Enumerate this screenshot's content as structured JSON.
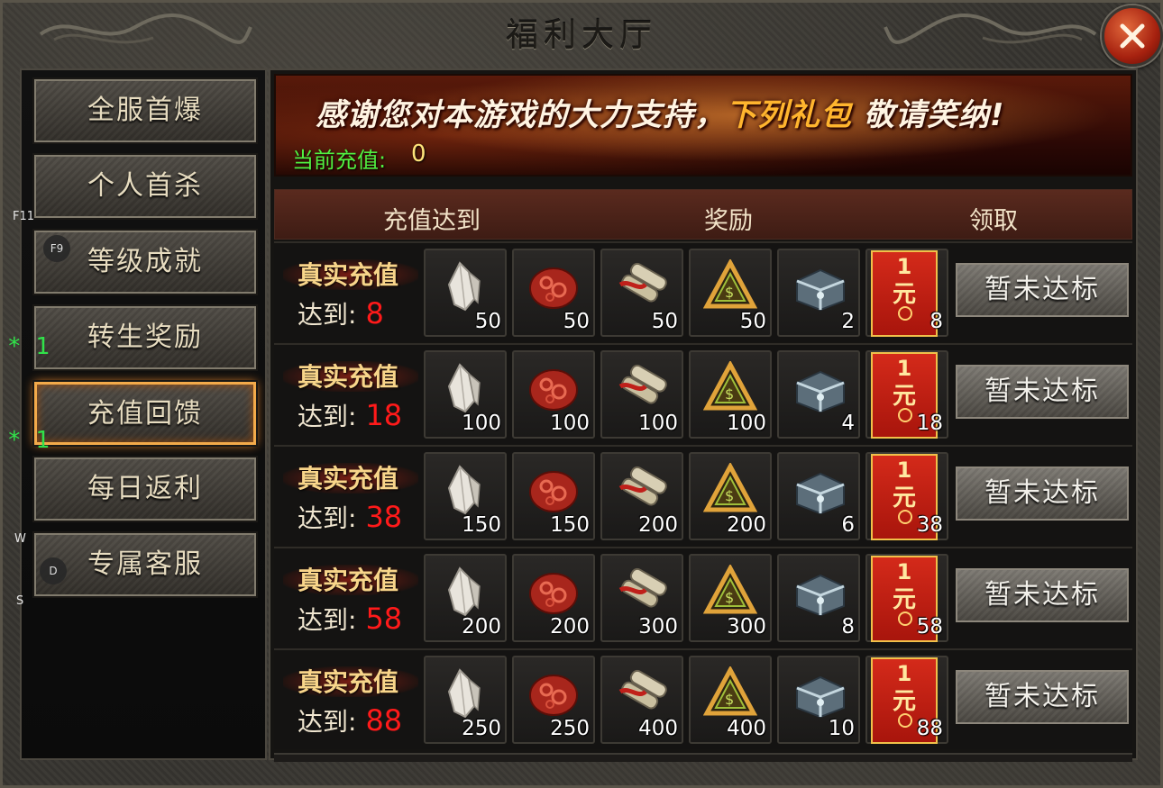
{
  "window": {
    "title": "福利大厅"
  },
  "sidebar": {
    "items": [
      {
        "label": "全服首爆"
      },
      {
        "label": "个人首杀"
      },
      {
        "label": "等级成就"
      },
      {
        "label": "转生奖励"
      },
      {
        "label": "充值回馈",
        "active": true
      },
      {
        "label": "每日返利"
      },
      {
        "label": "专属客服"
      }
    ]
  },
  "hotkeys": {
    "f11": "F11",
    "f9": "F9",
    "w": "W",
    "d": "D",
    "s": "S",
    "mark1": "* 1",
    "mark2": "* 1"
  },
  "banner": {
    "text_a": "感谢您对本游戏的大力支持，",
    "text_hl": "下列礼包",
    "text_b": " 敬请笑纳!",
    "current_label": "当前充值:",
    "current_value": "0"
  },
  "table": {
    "headers": {
      "req": "充值达到",
      "reward": "奖励",
      "claim": "领取"
    },
    "req_title": "真实充值",
    "req_prefix": "达到:",
    "card_top": "1",
    "card_bottom": "元",
    "rows": [
      {
        "amount": "8",
        "qty": [
          "50",
          "50",
          "50",
          "50",
          "2",
          "8"
        ],
        "claim": "暂未达标"
      },
      {
        "amount": "18",
        "qty": [
          "100",
          "100",
          "100",
          "100",
          "4",
          "18"
        ],
        "claim": "暂未达标"
      },
      {
        "amount": "38",
        "qty": [
          "150",
          "150",
          "200",
          "200",
          "6",
          "38"
        ],
        "claim": "暂未达标"
      },
      {
        "amount": "58",
        "qty": [
          "200",
          "200",
          "300",
          "300",
          "8",
          "58"
        ],
        "claim": "暂未达标"
      },
      {
        "amount": "88",
        "qty": [
          "250",
          "250",
          "400",
          "400",
          "10",
          "88"
        ],
        "claim": "暂未达标"
      }
    ],
    "item_icons": [
      "crystal-icon",
      "red-gem-icon",
      "scroll-icon",
      "triangle-rune-icon",
      "treasure-chest-icon",
      "red-envelope-icon"
    ]
  },
  "colors": {
    "accent": "#f3aa4a",
    "amount": "#ff1a1a",
    "current_label": "#51f041"
  }
}
